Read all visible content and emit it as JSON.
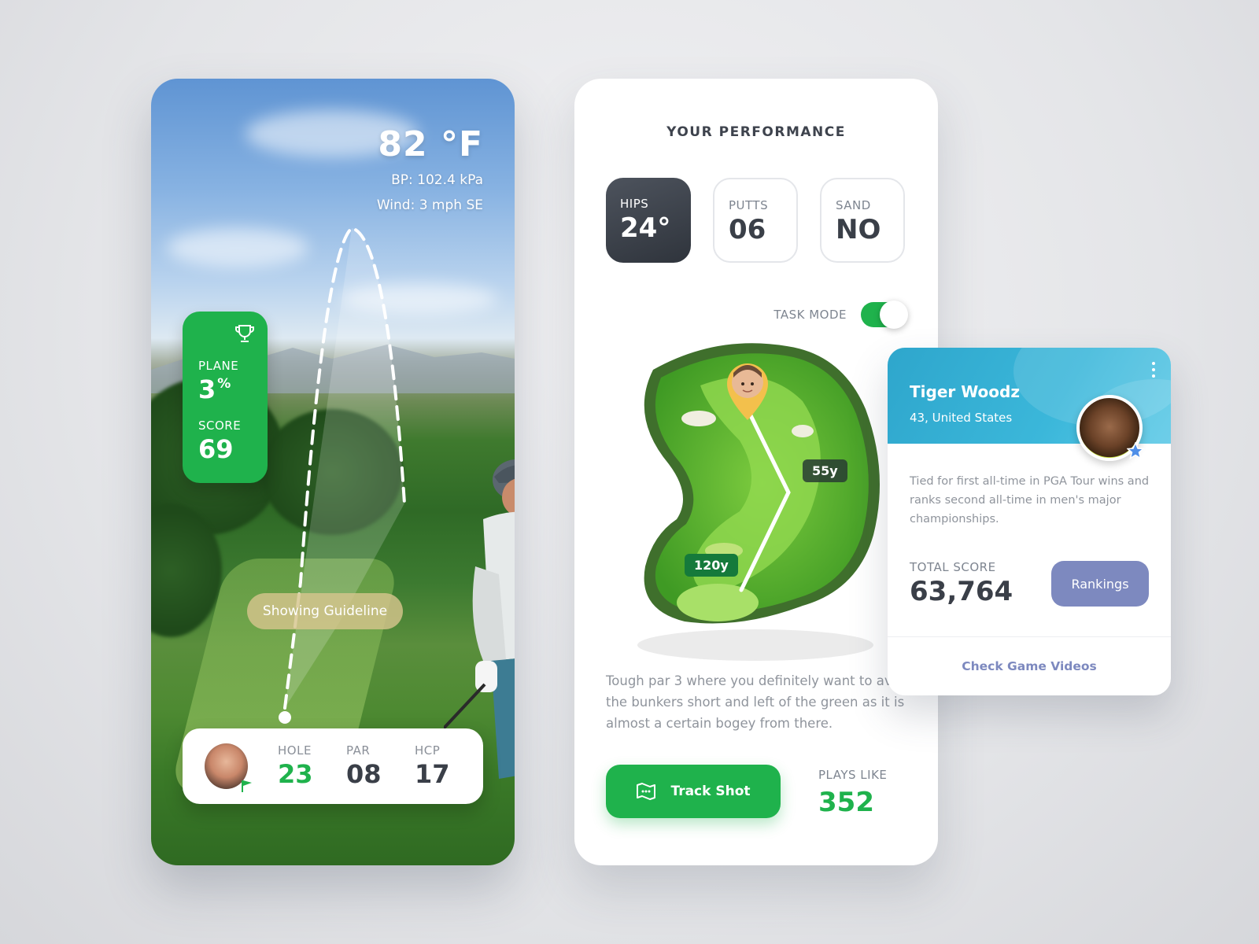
{
  "weather": {
    "temperature": "82 °F",
    "pressure": "BP: 102.4 kPa",
    "wind": "Wind: 3 mph SE"
  },
  "stats": {
    "plane_label": "PLANE",
    "plane_value": "3",
    "plane_unit": "%",
    "score_label": "SCORE",
    "score_value": "69"
  },
  "guideline_label": "Showing Guideline",
  "hole": {
    "hole_label": "HOLE",
    "hole_value": "23",
    "par_label": "PAR",
    "par_value": "08",
    "hcp_label": "HCP",
    "hcp_value": "17"
  },
  "performance": {
    "title": "YOUR PERFORMANCE",
    "metrics": [
      {
        "label": "HIPS",
        "value": "24°"
      },
      {
        "label": "PUTTS",
        "value": "06"
      },
      {
        "label": "SAND",
        "value": "NO"
      }
    ],
    "task_mode_label": "TASK MODE",
    "task_mode_on": true,
    "distance_far": "55y",
    "distance_near": "120y",
    "description": "Tough par 3 where you definitely want to avoid the bunkers short and left of the green as it is almost a certain bogey from there.",
    "track_shot_label": "Track Shot",
    "plays_like_label": "PLAYS LIKE",
    "plays_like_value": "352"
  },
  "profile": {
    "name": "Tiger Woodz",
    "subtitle": "43, United States",
    "bio": "Tied for first all-time in PGA Tour wins and ranks second all-time in men's major championships.",
    "total_score_label": "TOTAL SCORE",
    "total_score_value": "63,764",
    "rankings_label": "Rankings",
    "videos_label": "Check Game Videos"
  },
  "colors": {
    "accent_green": "#1fb24c",
    "profile_blue": "#3bb7da",
    "rankings_purple": "#7d89bf"
  }
}
